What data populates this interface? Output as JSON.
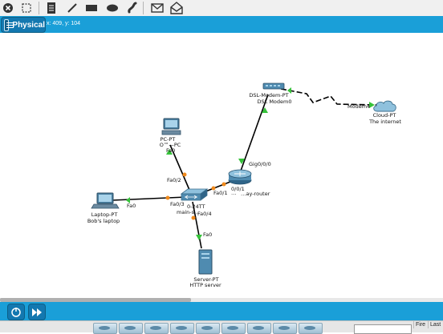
{
  "mode": {
    "label": "Physical",
    "coords": "x: 409, y: 104"
  },
  "toolbar": {
    "icons": [
      "close-icon",
      "select-icon",
      "note-icon",
      "line-icon",
      "rectangle-icon",
      "ellipse-icon",
      "freeform-icon",
      "add-pdu-icon",
      "complex-pdu-icon"
    ]
  },
  "devices": {
    "pc": {
      "type": "PC-PT",
      "name": "O™—PC"
    },
    "laptop": {
      "type": "Laptop-PT",
      "name": "Bob's laptop"
    },
    "switch": {
      "type": "0-24TT",
      "name": "main-s…"
    },
    "router": {
      "type": "…",
      "name": "…ay-router"
    },
    "server": {
      "type": "Server-PT",
      "name": "HTTP server"
    },
    "modem": {
      "type": "DSL-Modem-PT",
      "name": "DSL Modem0"
    },
    "cloud": {
      "type": "Cloud-PT",
      "name": "The internet"
    }
  },
  "ports": {
    "pc_fa0": "Fa0",
    "switch_fa02": "Fa0/2",
    "laptop_fa0": "Fa0",
    "switch_fa03": "Fa0/3",
    "switch_fa01": "Fa0/1",
    "router_g001": "0/0/1",
    "switch_fa04": "Fa0/4",
    "server_fa0": "Fa0",
    "router_g000": "Gig0/0/0",
    "cloud_modem4": "Modem4"
  },
  "colors": {
    "accent": "#1a9fd8",
    "link": "#000000",
    "link_up": "#36c23a",
    "link_pending": "#f08a1c",
    "serial_link": "#000000"
  },
  "bottom": {
    "tab_fire": "Fire",
    "tab_last": "Last"
  }
}
